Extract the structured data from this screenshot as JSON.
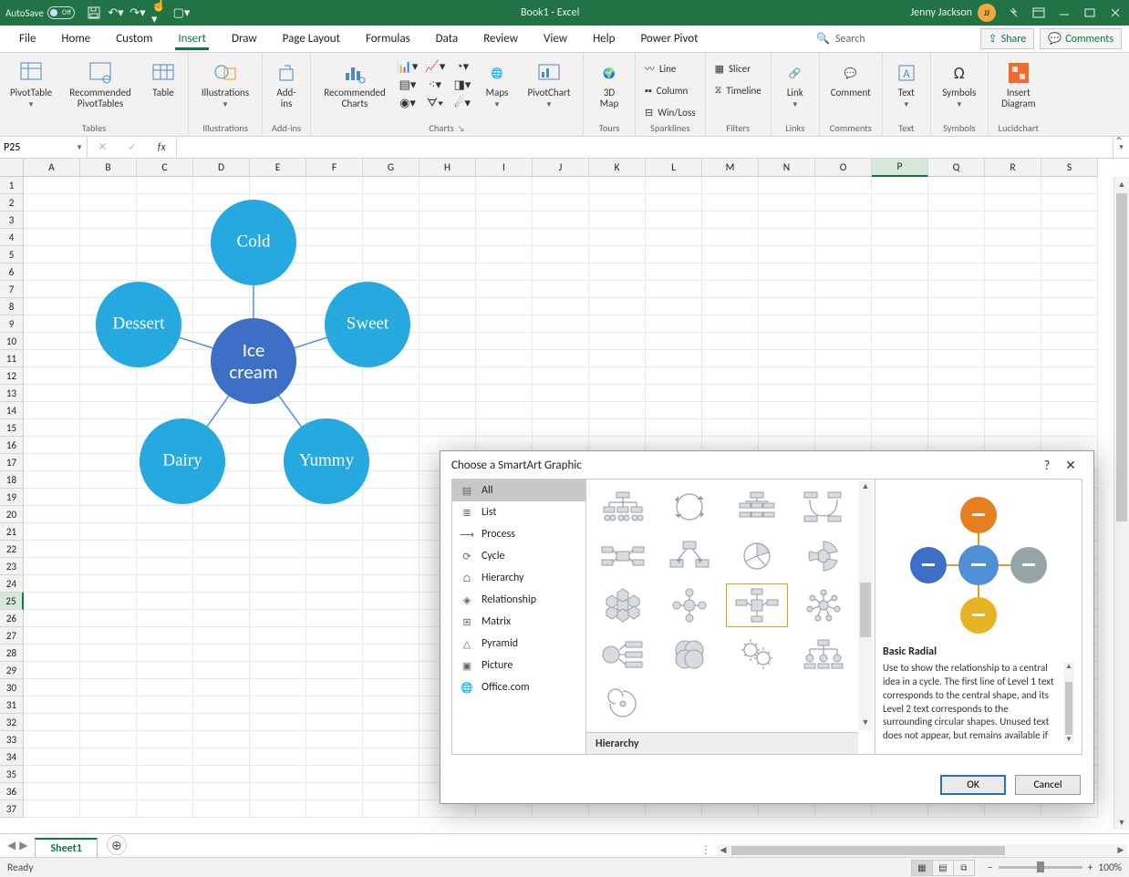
{
  "titlebar": {
    "autosave_label": "AutoSave",
    "autosave_state": "Off",
    "title": "Book1 - Excel",
    "user_name": "Jenny Jackson",
    "user_initials": "JJ"
  },
  "tabs": {
    "items": [
      "File",
      "Home",
      "Custom",
      "Insert",
      "Draw",
      "Page Layout",
      "Formulas",
      "Data",
      "Review",
      "View",
      "Help",
      "Power Pivot"
    ],
    "active": "Insert",
    "search": "Search",
    "share": "Share",
    "comments": "Comments"
  },
  "ribbon": {
    "tables": {
      "pivot": "PivotTable",
      "recpivot": "Recommended\nPivotTables",
      "table": "Table",
      "label": "Tables"
    },
    "illus": {
      "btn": "Illustrations",
      "label": "Illustrations"
    },
    "addins": {
      "btn": "Add-\nins",
      "label": "Add-ins"
    },
    "charts": {
      "rec": "Recommended\nCharts",
      "maps": "Maps",
      "pivotchart": "PivotChart",
      "label": "Charts"
    },
    "tours": {
      "btn": "3D\nMap",
      "label": "Tours"
    },
    "sparklines": {
      "line": "Line",
      "column": "Column",
      "winloss": "Win/Loss",
      "label": "Sparklines"
    },
    "filters": {
      "slicer": "Slicer",
      "timeline": "Timeline",
      "label": "Filters"
    },
    "links": {
      "btn": "Link",
      "label": "Links"
    },
    "comments": {
      "btn": "Comment",
      "label": "Comments"
    },
    "text": {
      "btn": "Text",
      "label": "Text"
    },
    "symbols": {
      "btn": "Symbols",
      "label": "Symbols"
    },
    "lucid": {
      "btn": "Insert\nDiagram",
      "label": "Lucidchart"
    }
  },
  "formula": {
    "namebox": "P25"
  },
  "columns": [
    "A",
    "B",
    "C",
    "D",
    "E",
    "F",
    "G",
    "H",
    "I",
    "J",
    "K",
    "L",
    "M",
    "N",
    "O",
    "P",
    "Q",
    "R",
    "S"
  ],
  "rows_count": 37,
  "sel": {
    "col": "P",
    "row": 25
  },
  "smartart": {
    "center": "Ice\ncream",
    "items": [
      "Cold",
      "Sweet",
      "Yummy",
      "Dairy",
      "Dessert"
    ]
  },
  "dialog": {
    "title": "Choose a SmartArt Graphic",
    "categories": [
      "All",
      "List",
      "Process",
      "Cycle",
      "Hierarchy",
      "Relationship",
      "Matrix",
      "Pyramid",
      "Picture",
      "Office.com"
    ],
    "selected_cat": "All",
    "section_header": "Hierarchy",
    "preview_name": "Basic Radial",
    "preview_desc": "Use to show the relationship to a central idea in a cycle. The first line of Level 1 text corresponds to the central shape, and its Level 2 text corresponds to the surrounding circular shapes. Unused text does not appear, but remains available if you switch",
    "ok": "OK",
    "cancel": "Cancel"
  },
  "sheets": {
    "active": "Sheet1"
  },
  "status": {
    "ready": "Ready",
    "zoom": "100%"
  }
}
